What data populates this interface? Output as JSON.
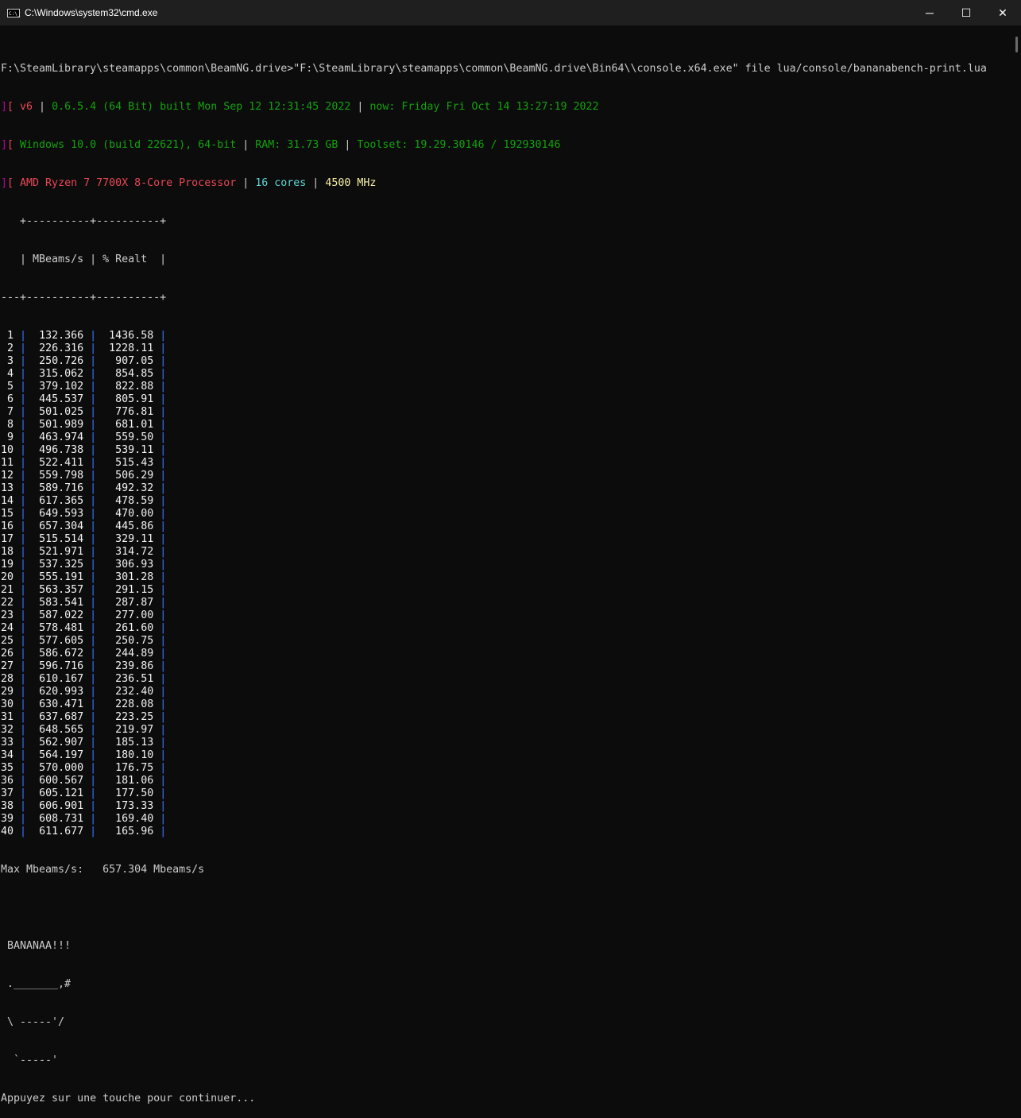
{
  "window": {
    "title": "C:\\Windows\\system32\\cmd.exe",
    "minimize": "─",
    "maximize": "☐",
    "close": "✕"
  },
  "command": "F:\\SteamLibrary\\steamapps\\common\\BeamNG.drive>\"F:\\SteamLibrary\\steamapps\\common\\BeamNG.drive\\Bin64\\\\console.x64.exe\" file lua/console/bananabench-print.lua",
  "info": {
    "version": "v6",
    "build": "0.6.5.4 (64 Bit) built Mon Sep 12 12:31:45 2022",
    "now": "now: Friday Fri Oct 14 13:27:19 2022",
    "os": "Windows 10.0 (build 22621), 64-bit",
    "ram": "RAM: 31.73 GB",
    "toolset": "Toolset: 19.29.30146 / 192930146",
    "cpu": "AMD Ryzen 7 7700X 8-Core Processor",
    "cores": "16 cores",
    "mhz": "4500 MHz"
  },
  "table": {
    "headers": [
      "MBeams/s",
      "% Realt"
    ],
    "rows": [
      [
        "1",
        "132.366",
        "1436.58"
      ],
      [
        "2",
        "226.316",
        "1228.11"
      ],
      [
        "3",
        "250.726",
        "907.05"
      ],
      [
        "4",
        "315.062",
        "854.85"
      ],
      [
        "5",
        "379.102",
        "822.88"
      ],
      [
        "6",
        "445.537",
        "805.91"
      ],
      [
        "7",
        "501.025",
        "776.81"
      ],
      [
        "8",
        "501.989",
        "681.01"
      ],
      [
        "9",
        "463.974",
        "559.50"
      ],
      [
        "10",
        "496.738",
        "539.11"
      ],
      [
        "11",
        "522.411",
        "515.43"
      ],
      [
        "12",
        "559.798",
        "506.29"
      ],
      [
        "13",
        "589.716",
        "492.32"
      ],
      [
        "14",
        "617.365",
        "478.59"
      ],
      [
        "15",
        "649.593",
        "470.00"
      ],
      [
        "16",
        "657.304",
        "445.86"
      ],
      [
        "17",
        "515.514",
        "329.11"
      ],
      [
        "18",
        "521.971",
        "314.72"
      ],
      [
        "19",
        "537.325",
        "306.93"
      ],
      [
        "20",
        "555.191",
        "301.28"
      ],
      [
        "21",
        "563.357",
        "291.15"
      ],
      [
        "22",
        "583.541",
        "287.87"
      ],
      [
        "23",
        "587.022",
        "277.00"
      ],
      [
        "24",
        "578.481",
        "261.60"
      ],
      [
        "25",
        "577.605",
        "250.75"
      ],
      [
        "26",
        "586.672",
        "244.89"
      ],
      [
        "27",
        "596.716",
        "239.86"
      ],
      [
        "28",
        "610.167",
        "236.51"
      ],
      [
        "29",
        "620.993",
        "232.40"
      ],
      [
        "30",
        "630.471",
        "228.08"
      ],
      [
        "31",
        "637.687",
        "223.25"
      ],
      [
        "32",
        "648.565",
        "219.97"
      ],
      [
        "33",
        "562.907",
        "185.13"
      ],
      [
        "34",
        "564.197",
        "180.10"
      ],
      [
        "35",
        "570.000",
        "176.75"
      ],
      [
        "36",
        "600.567",
        "181.06"
      ],
      [
        "37",
        "605.121",
        "177.50"
      ],
      [
        "38",
        "606.901",
        "173.33"
      ],
      [
        "39",
        "608.731",
        "169.40"
      ],
      [
        "40",
        "611.677",
        "165.96"
      ]
    ]
  },
  "max_line": "Max Mbeams/s:   657.304 Mbeams/s",
  "banana": [
    " BANANAA!!!",
    " ._______,#",
    " \\ -----'/",
    "  `-----'"
  ],
  "prompt": "Appuyez sur une touche pour continuer..."
}
